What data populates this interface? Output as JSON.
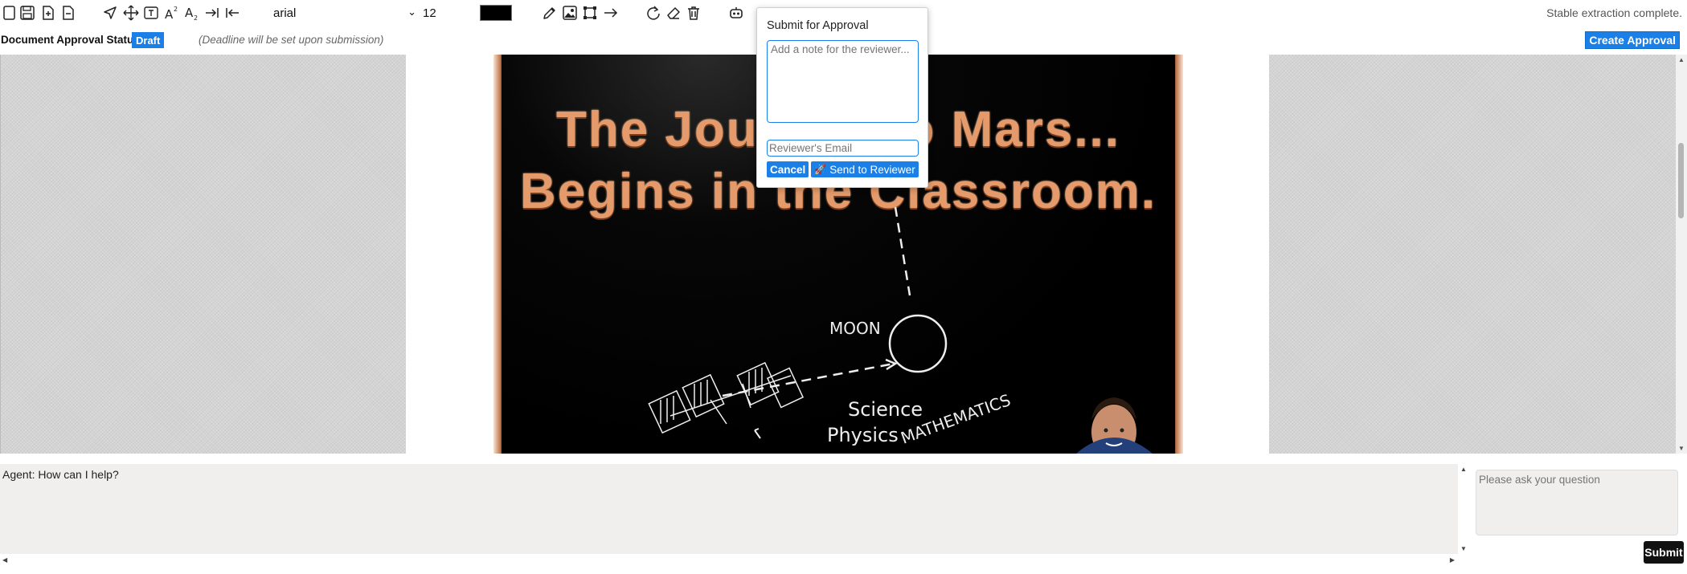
{
  "toolbar": {
    "font_family": "arial",
    "font_size": "12",
    "text_color": "#000000",
    "icons": [
      "new-document-icon",
      "save-icon",
      "add-page-icon",
      "remove-page-icon",
      "select-arrow-icon",
      "move-icon",
      "text-box-icon",
      "superscript-icon",
      "subscript-icon",
      "indent-icon",
      "outdent-icon",
      "pencil-icon",
      "image-icon",
      "crop-icon",
      "arrow-right-icon",
      "rotate-icon",
      "eraser-icon",
      "trash-icon",
      "robot-icon"
    ]
  },
  "status": "Stable extraction complete.",
  "approval": {
    "title": "Document Approval Status",
    "badge": "Draft",
    "deadline_note": "(Deadline will be set upon submission)",
    "create_label": "Create Approval"
  },
  "poster": {
    "line1": "The Journey to Mars...",
    "line2": "Begins in the Classroom.",
    "chalk_moon": "MOON",
    "chalk_science": "Science",
    "chalk_physics": "Physics",
    "chalk_math": "MATHEMATICS"
  },
  "modal": {
    "title": "Submit for Approval",
    "note_placeholder": "Add a note for the reviewer...",
    "email_placeholder": "Reviewer's Email",
    "cancel_label": "Cancel",
    "send_label": "Send to Reviewer"
  },
  "chat": {
    "log_text": "Agent: How can I help?",
    "input_placeholder": "Please ask your question",
    "submit_label": "Submit"
  },
  "colors": {
    "accent": "#1a7fe6",
    "poster_text": "#e49a6a"
  }
}
